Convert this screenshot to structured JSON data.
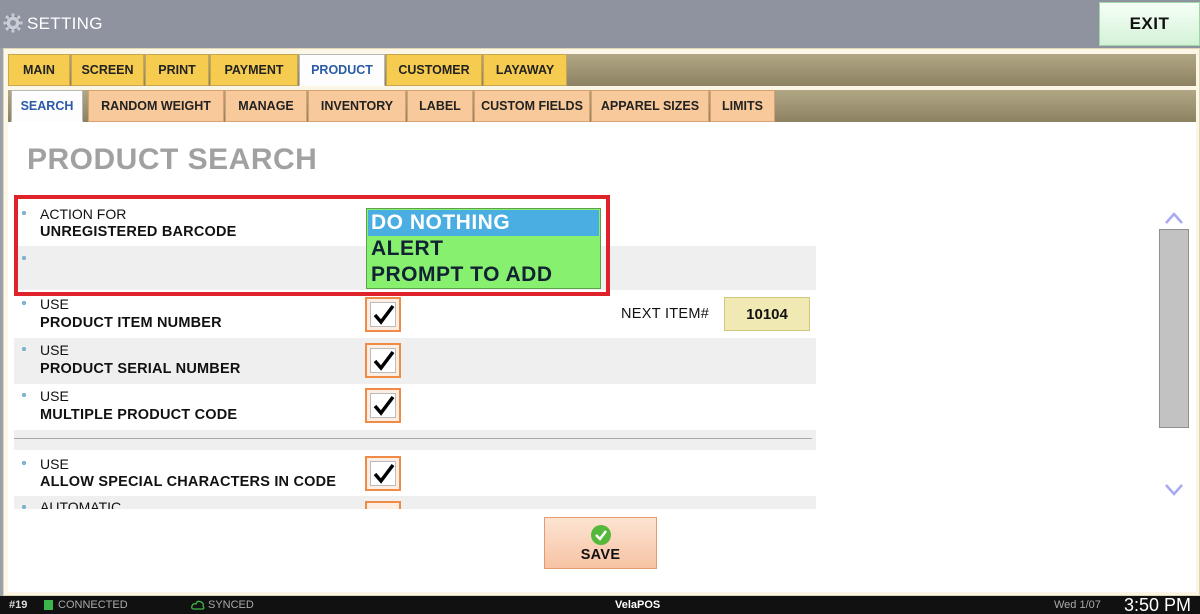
{
  "titlebar": {
    "title": "SETTING",
    "exit_label": "EXIT"
  },
  "main_tabs": [
    {
      "label": "MAIN",
      "active": false
    },
    {
      "label": "SCREEN",
      "active": false
    },
    {
      "label": "PRINT",
      "active": false
    },
    {
      "label": "PAYMENT",
      "active": false
    },
    {
      "label": "PRODUCT",
      "active": true
    },
    {
      "label": "CUSTOMER",
      "active": false
    },
    {
      "label": "LAYAWAY",
      "active": false
    }
  ],
  "sub_tabs": [
    {
      "label": "SEARCH",
      "active": true
    },
    {
      "label": "RANDOM WEIGHT",
      "active": false
    },
    {
      "label": "MANAGE",
      "active": false
    },
    {
      "label": "INVENTORY",
      "active": false
    },
    {
      "label": "LABEL",
      "active": false
    },
    {
      "label": "CUSTOM FIELDS",
      "active": false
    },
    {
      "label": "APPAREL SIZES",
      "active": false
    },
    {
      "label": "LIMITS",
      "active": false
    }
  ],
  "page": {
    "heading": "PRODUCT SEARCH"
  },
  "barcode_action": {
    "label_top": "ACTION FOR",
    "label_bottom": "UNREGISTERED BARCODE",
    "options": [
      "DO NOTHING",
      "ALERT",
      "PROMPT TO ADD"
    ],
    "selected": "DO NOTHING"
  },
  "settings": [
    {
      "top": "USE",
      "bottom": "PRODUCT ITEM NUMBER",
      "checked": true
    },
    {
      "top": "USE",
      "bottom": "PRODUCT SERIAL NUMBER",
      "checked": true
    },
    {
      "top": "USE",
      "bottom": "MULTIPLE PRODUCT CODE",
      "checked": true
    },
    {
      "top": "USE",
      "bottom": "ALLOW SPECIAL CHARACTERS IN CODE",
      "checked": true
    },
    {
      "top": "AUTOMATIC",
      "bottom": "",
      "checked": true
    }
  ],
  "next_item": {
    "label": "NEXT ITEM#",
    "value": "10104"
  },
  "save_label": "SAVE",
  "statusbar": {
    "station": "#19",
    "connection": "CONNECTED",
    "sync": "SYNCED",
    "app": "VelaPOS",
    "date": "Wed 1/07",
    "time": "3:50 PM"
  },
  "colors": {
    "main_tab": "#f6cc50",
    "sub_tab": "#f8c99a",
    "active_tab_text": "#2a5aa8",
    "highlight": "#e0232a",
    "listbox": "#87f06e",
    "listbox_selected": "#4aaee2",
    "checkbox_border": "#ef8a47"
  }
}
